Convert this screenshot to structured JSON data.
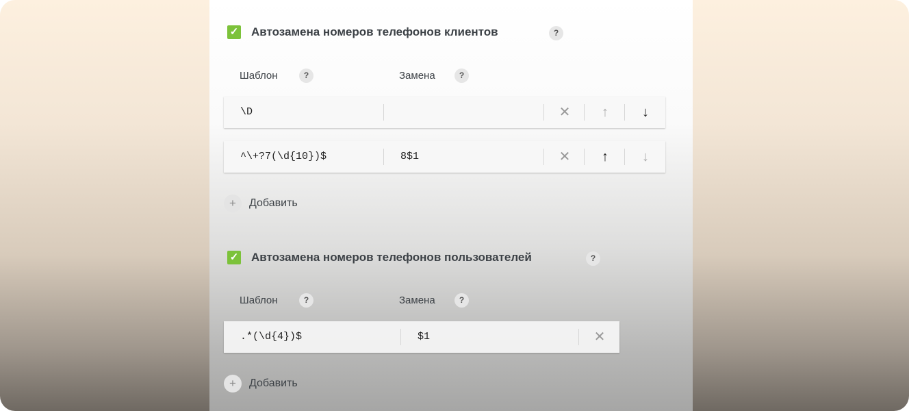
{
  "client_section": {
    "enabled": true,
    "check_glyph": "✓",
    "title": "Автозамена номеров телефонов клиентов",
    "help": "?",
    "template_label": "Шаблон",
    "template_help": "?",
    "replace_label": "Замена",
    "replace_help": "?",
    "rules": [
      {
        "template": "\\D",
        "replacement": "",
        "delete_glyph": "✕",
        "up_glyph": "↑",
        "down_glyph": "↓",
        "up_enabled": false,
        "down_enabled": true
      },
      {
        "template": "^\\+?7(\\d{10})$",
        "replacement": "8$1",
        "delete_glyph": "✕",
        "up_glyph": "↑",
        "down_glyph": "↓",
        "up_enabled": true,
        "down_enabled": false
      }
    ],
    "add_icon": "+",
    "add_label": "Добавить"
  },
  "user_section": {
    "enabled": true,
    "check_glyph": "✓",
    "title": "Автозамена номеров телефонов пользователей",
    "help": "?",
    "template_label": "Шаблон",
    "template_help": "?",
    "replace_label": "Замена",
    "replace_help": "?",
    "rules": [
      {
        "template": ".*(\\d{4})$",
        "replacement": "$1",
        "delete_glyph": "✕"
      }
    ],
    "add_icon": "+",
    "add_label": "Добавить"
  },
  "colors": {
    "checkbox": "#7cc23a",
    "text": "#3c4146"
  }
}
